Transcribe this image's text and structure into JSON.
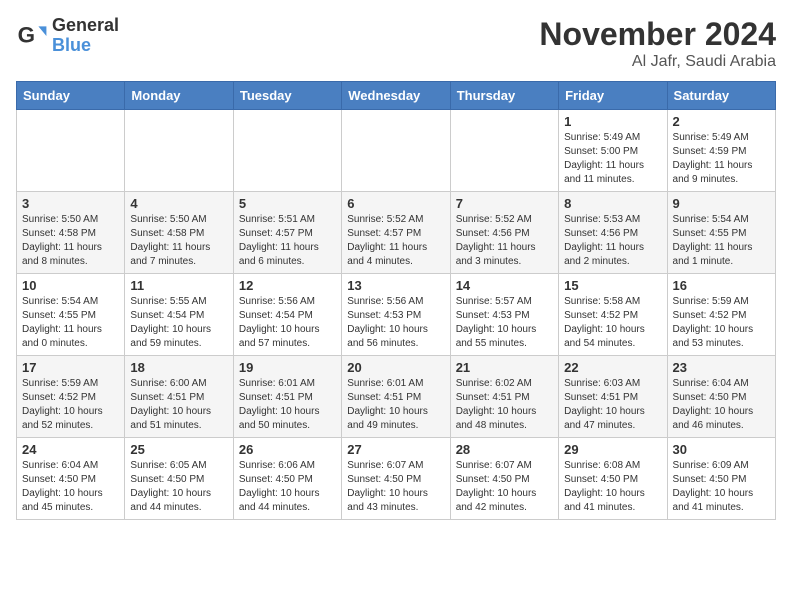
{
  "logo": {
    "general": "General",
    "blue": "Blue"
  },
  "header": {
    "month": "November 2024",
    "location": "Al Jafr, Saudi Arabia"
  },
  "weekdays": [
    "Sunday",
    "Monday",
    "Tuesday",
    "Wednesday",
    "Thursday",
    "Friday",
    "Saturday"
  ],
  "weeks": [
    [
      {
        "day": "",
        "info": ""
      },
      {
        "day": "",
        "info": ""
      },
      {
        "day": "",
        "info": ""
      },
      {
        "day": "",
        "info": ""
      },
      {
        "day": "",
        "info": ""
      },
      {
        "day": "1",
        "info": "Sunrise: 5:49 AM\nSunset: 5:00 PM\nDaylight: 11 hours and 11 minutes."
      },
      {
        "day": "2",
        "info": "Sunrise: 5:49 AM\nSunset: 4:59 PM\nDaylight: 11 hours and 9 minutes."
      }
    ],
    [
      {
        "day": "3",
        "info": "Sunrise: 5:50 AM\nSunset: 4:58 PM\nDaylight: 11 hours and 8 minutes."
      },
      {
        "day": "4",
        "info": "Sunrise: 5:50 AM\nSunset: 4:58 PM\nDaylight: 11 hours and 7 minutes."
      },
      {
        "day": "5",
        "info": "Sunrise: 5:51 AM\nSunset: 4:57 PM\nDaylight: 11 hours and 6 minutes."
      },
      {
        "day": "6",
        "info": "Sunrise: 5:52 AM\nSunset: 4:57 PM\nDaylight: 11 hours and 4 minutes."
      },
      {
        "day": "7",
        "info": "Sunrise: 5:52 AM\nSunset: 4:56 PM\nDaylight: 11 hours and 3 minutes."
      },
      {
        "day": "8",
        "info": "Sunrise: 5:53 AM\nSunset: 4:56 PM\nDaylight: 11 hours and 2 minutes."
      },
      {
        "day": "9",
        "info": "Sunrise: 5:54 AM\nSunset: 4:55 PM\nDaylight: 11 hours and 1 minute."
      }
    ],
    [
      {
        "day": "10",
        "info": "Sunrise: 5:54 AM\nSunset: 4:55 PM\nDaylight: 11 hours and 0 minutes."
      },
      {
        "day": "11",
        "info": "Sunrise: 5:55 AM\nSunset: 4:54 PM\nDaylight: 10 hours and 59 minutes."
      },
      {
        "day": "12",
        "info": "Sunrise: 5:56 AM\nSunset: 4:54 PM\nDaylight: 10 hours and 57 minutes."
      },
      {
        "day": "13",
        "info": "Sunrise: 5:56 AM\nSunset: 4:53 PM\nDaylight: 10 hours and 56 minutes."
      },
      {
        "day": "14",
        "info": "Sunrise: 5:57 AM\nSunset: 4:53 PM\nDaylight: 10 hours and 55 minutes."
      },
      {
        "day": "15",
        "info": "Sunrise: 5:58 AM\nSunset: 4:52 PM\nDaylight: 10 hours and 54 minutes."
      },
      {
        "day": "16",
        "info": "Sunrise: 5:59 AM\nSunset: 4:52 PM\nDaylight: 10 hours and 53 minutes."
      }
    ],
    [
      {
        "day": "17",
        "info": "Sunrise: 5:59 AM\nSunset: 4:52 PM\nDaylight: 10 hours and 52 minutes."
      },
      {
        "day": "18",
        "info": "Sunrise: 6:00 AM\nSunset: 4:51 PM\nDaylight: 10 hours and 51 minutes."
      },
      {
        "day": "19",
        "info": "Sunrise: 6:01 AM\nSunset: 4:51 PM\nDaylight: 10 hours and 50 minutes."
      },
      {
        "day": "20",
        "info": "Sunrise: 6:01 AM\nSunset: 4:51 PM\nDaylight: 10 hours and 49 minutes."
      },
      {
        "day": "21",
        "info": "Sunrise: 6:02 AM\nSunset: 4:51 PM\nDaylight: 10 hours and 48 minutes."
      },
      {
        "day": "22",
        "info": "Sunrise: 6:03 AM\nSunset: 4:51 PM\nDaylight: 10 hours and 47 minutes."
      },
      {
        "day": "23",
        "info": "Sunrise: 6:04 AM\nSunset: 4:50 PM\nDaylight: 10 hours and 46 minutes."
      }
    ],
    [
      {
        "day": "24",
        "info": "Sunrise: 6:04 AM\nSunset: 4:50 PM\nDaylight: 10 hours and 45 minutes."
      },
      {
        "day": "25",
        "info": "Sunrise: 6:05 AM\nSunset: 4:50 PM\nDaylight: 10 hours and 44 minutes."
      },
      {
        "day": "26",
        "info": "Sunrise: 6:06 AM\nSunset: 4:50 PM\nDaylight: 10 hours and 44 minutes."
      },
      {
        "day": "27",
        "info": "Sunrise: 6:07 AM\nSunset: 4:50 PM\nDaylight: 10 hours and 43 minutes."
      },
      {
        "day": "28",
        "info": "Sunrise: 6:07 AM\nSunset: 4:50 PM\nDaylight: 10 hours and 42 minutes."
      },
      {
        "day": "29",
        "info": "Sunrise: 6:08 AM\nSunset: 4:50 PM\nDaylight: 10 hours and 41 minutes."
      },
      {
        "day": "30",
        "info": "Sunrise: 6:09 AM\nSunset: 4:50 PM\nDaylight: 10 hours and 41 minutes."
      }
    ]
  ]
}
